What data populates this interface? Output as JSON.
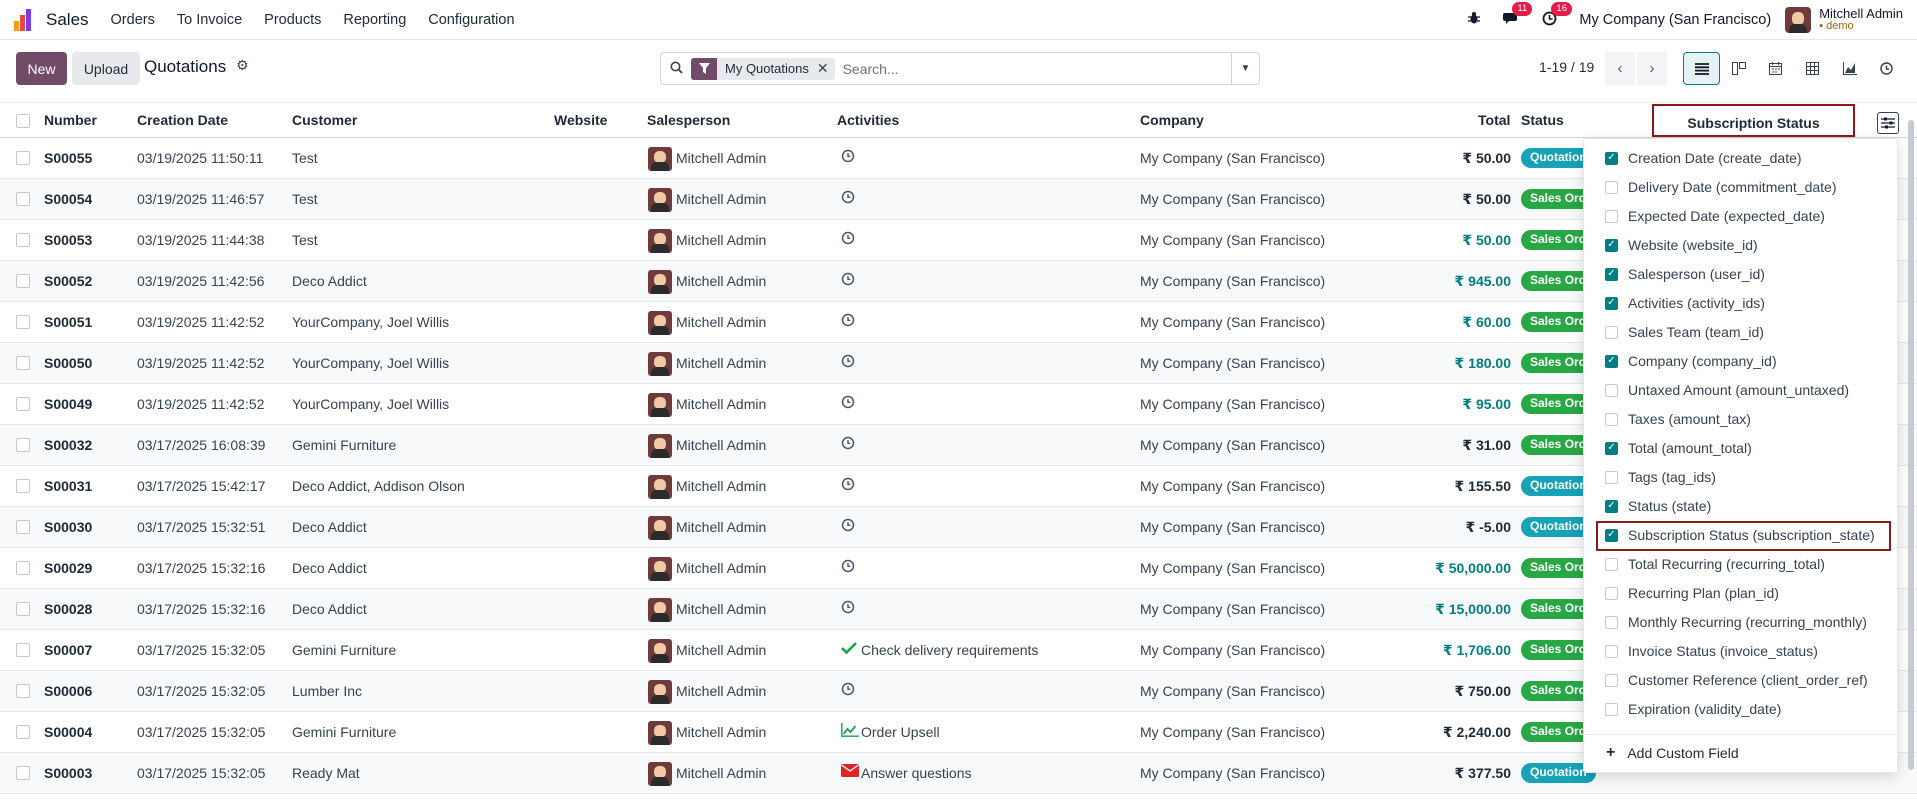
{
  "navbar": {
    "brand": "Sales",
    "menu": [
      "Orders",
      "To Invoice",
      "Products",
      "Reporting",
      "Configuration"
    ],
    "chat_badge": "11",
    "activity_badge": "16",
    "company": "My Company (San Francisco)",
    "user_name": "Mitchell Admin",
    "database": "demo"
  },
  "control_panel": {
    "new_label": "New",
    "upload_label": "Upload",
    "title": "Quotations",
    "facet_label": "My Quotations",
    "search_placeholder": "Search...",
    "pager": "1-19 / 19",
    "views": [
      "list-view-icon",
      "kanban-view-icon",
      "calendar-view-icon",
      "pivot-view-icon",
      "graph-view-icon",
      "activity-view-icon"
    ]
  },
  "columns": {
    "number": "Number",
    "creation_date": "Creation Date",
    "customer": "Customer",
    "website": "Website",
    "salesperson": "Salesperson",
    "activities": "Activities",
    "company": "Company",
    "total": "Total",
    "status": "Status",
    "subscription_status": "Subscription Status"
  },
  "rows": [
    {
      "number": "S00055",
      "date": "03/19/2025 11:50:11",
      "customer": "Test",
      "salesperson": "Mitchell Admin",
      "activity": "",
      "activity_icon": "clock-icon",
      "company": "My Company (San Francisco)",
      "total": "₹ 50.00",
      "total_teal": false,
      "status": "Quotation",
      "status_color": "teal"
    },
    {
      "number": "S00054",
      "date": "03/19/2025 11:46:57",
      "customer": "Test",
      "salesperson": "Mitchell Admin",
      "activity": "",
      "activity_icon": "clock-icon",
      "company": "My Company (San Francisco)",
      "total": "₹ 50.00",
      "total_teal": false,
      "status": "Sales Order",
      "status_color": "green"
    },
    {
      "number": "S00053",
      "date": "03/19/2025 11:44:38",
      "customer": "Test",
      "salesperson": "Mitchell Admin",
      "activity": "",
      "activity_icon": "clock-icon",
      "company": "My Company (San Francisco)",
      "total": "₹ 50.00",
      "total_teal": true,
      "status": "Sales Order",
      "status_color": "green"
    },
    {
      "number": "S00052",
      "date": "03/19/2025 11:42:56",
      "customer": "Deco Addict",
      "salesperson": "Mitchell Admin",
      "activity": "",
      "activity_icon": "clock-icon",
      "company": "My Company (San Francisco)",
      "total": "₹ 945.00",
      "total_teal": true,
      "status": "Sales Order",
      "status_color": "green"
    },
    {
      "number": "S00051",
      "date": "03/19/2025 11:42:52",
      "customer": "YourCompany, Joel Willis",
      "salesperson": "Mitchell Admin",
      "activity": "",
      "activity_icon": "clock-icon",
      "company": "My Company (San Francisco)",
      "total": "₹ 60.00",
      "total_teal": true,
      "status": "Sales Order",
      "status_color": "green"
    },
    {
      "number": "S00050",
      "date": "03/19/2025 11:42:52",
      "customer": "YourCompany, Joel Willis",
      "salesperson": "Mitchell Admin",
      "activity": "",
      "activity_icon": "clock-icon",
      "company": "My Company (San Francisco)",
      "total": "₹ 180.00",
      "total_teal": true,
      "status": "Sales Order",
      "status_color": "green"
    },
    {
      "number": "S00049",
      "date": "03/19/2025 11:42:52",
      "customer": "YourCompany, Joel Willis",
      "salesperson": "Mitchell Admin",
      "activity": "",
      "activity_icon": "clock-icon",
      "company": "My Company (San Francisco)",
      "total": "₹ 95.00",
      "total_teal": true,
      "status": "Sales Order",
      "status_color": "green"
    },
    {
      "number": "S00032",
      "date": "03/17/2025 16:08:39",
      "customer": "Gemini Furniture",
      "salesperson": "Mitchell Admin",
      "activity": "",
      "activity_icon": "clock-icon",
      "company": "My Company (San Francisco)",
      "total": "₹ 31.00",
      "total_teal": false,
      "status": "Sales Order",
      "status_color": "green"
    },
    {
      "number": "S00031",
      "date": "03/17/2025 15:42:17",
      "customer": "Deco Addict, Addison Olson",
      "salesperson": "Mitchell Admin",
      "activity": "",
      "activity_icon": "clock-icon",
      "company": "My Company (San Francisco)",
      "total": "₹ 155.50",
      "total_teal": false,
      "status": "Quotation",
      "status_color": "teal"
    },
    {
      "number": "S00030",
      "date": "03/17/2025 15:32:51",
      "customer": "Deco Addict",
      "salesperson": "Mitchell Admin",
      "activity": "",
      "activity_icon": "clock-icon",
      "company": "My Company (San Francisco)",
      "total": "₹ -5.00",
      "total_teal": false,
      "status": "Quotation",
      "status_color": "teal"
    },
    {
      "number": "S00029",
      "date": "03/17/2025 15:32:16",
      "customer": "Deco Addict",
      "salesperson": "Mitchell Admin",
      "activity": "",
      "activity_icon": "clock-icon",
      "company": "My Company (San Francisco)",
      "total": "₹ 50,000.00",
      "total_teal": true,
      "status": "Sales Order",
      "status_color": "green"
    },
    {
      "number": "S00028",
      "date": "03/17/2025 15:32:16",
      "customer": "Deco Addict",
      "salesperson": "Mitchell Admin",
      "activity": "",
      "activity_icon": "clock-icon",
      "company": "My Company (San Francisco)",
      "total": "₹ 15,000.00",
      "total_teal": true,
      "status": "Sales Order",
      "status_color": "green"
    },
    {
      "number": "S00007",
      "date": "03/17/2025 15:32:05",
      "customer": "Gemini Furniture",
      "salesperson": "Mitchell Admin",
      "activity": "Check delivery requirements",
      "activity_icon": "check-icon",
      "company": "My Company (San Francisco)",
      "total": "₹ 1,706.00",
      "total_teal": true,
      "status": "Sales Order",
      "status_color": "green"
    },
    {
      "number": "S00006",
      "date": "03/17/2025 15:32:05",
      "customer": "Lumber Inc",
      "salesperson": "Mitchell Admin",
      "activity": "",
      "activity_icon": "clock-icon",
      "company": "My Company (San Francisco)",
      "total": "₹ 750.00",
      "total_teal": false,
      "status": "Sales Order",
      "status_color": "green"
    },
    {
      "number": "S00004",
      "date": "03/17/2025 15:32:05",
      "customer": "Gemini Furniture",
      "salesperson": "Mitchell Admin",
      "activity": "Order Upsell",
      "activity_icon": "chart-line-icon",
      "company": "My Company (San Francisco)",
      "total": "₹ 2,240.00",
      "total_teal": false,
      "status": "Sales Order",
      "status_color": "green"
    },
    {
      "number": "S00003",
      "date": "03/17/2025 15:32:05",
      "customer": "Ready Mat",
      "salesperson": "Mitchell Admin",
      "activity": "Answer questions",
      "activity_icon": "envelope-icon",
      "company": "My Company (San Francisco)",
      "total": "₹ 377.50",
      "total_teal": false,
      "status": "Quotation",
      "status_color": "teal"
    }
  ],
  "optional_columns": [
    {
      "label": "Creation Date (create_date)",
      "checked": true
    },
    {
      "label": "Delivery Date (commitment_date)",
      "checked": false
    },
    {
      "label": "Expected Date (expected_date)",
      "checked": false
    },
    {
      "label": "Website (website_id)",
      "checked": true
    },
    {
      "label": "Salesperson (user_id)",
      "checked": true
    },
    {
      "label": "Activities (activity_ids)",
      "checked": true
    },
    {
      "label": "Sales Team (team_id)",
      "checked": false
    },
    {
      "label": "Company (company_id)",
      "checked": true
    },
    {
      "label": "Untaxed Amount (amount_untaxed)",
      "checked": false
    },
    {
      "label": "Taxes (amount_tax)",
      "checked": false
    },
    {
      "label": "Total (amount_total)",
      "checked": true
    },
    {
      "label": "Tags (tag_ids)",
      "checked": false
    },
    {
      "label": "Status (state)",
      "checked": true
    },
    {
      "label": "Subscription Status (subscription_state)",
      "checked": true
    },
    {
      "label": "Total Recurring (recurring_total)",
      "checked": false
    },
    {
      "label": "Recurring Plan (plan_id)",
      "checked": false
    },
    {
      "label": "Monthly Recurring (recurring_monthly)",
      "checked": false
    },
    {
      "label": "Invoice Status (invoice_status)",
      "checked": false
    },
    {
      "label": "Customer Reference (client_order_ref)",
      "checked": false
    },
    {
      "label": "Expiration (validity_date)",
      "checked": false
    }
  ],
  "add_custom_field": "Add Custom Field",
  "colors": {
    "brand": "#714b67",
    "accent": "#017e84",
    "status_green": "#28a745",
    "status_teal": "#17a2b8",
    "highlight_border": "#8b1a1a"
  }
}
